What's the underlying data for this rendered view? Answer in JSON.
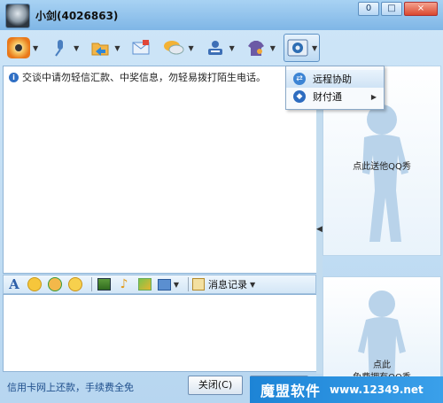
{
  "window": {
    "title": "小剑(4026863)",
    "controls": {
      "minimize": "0",
      "maximize": "□",
      "close": "×"
    }
  },
  "toolbar": {
    "items": [
      {
        "name": "video",
        "icon": "webcam-icon",
        "glyph": "●",
        "color": "#f29a1c"
      },
      {
        "name": "voice",
        "icon": "microphone-icon",
        "glyph": "🎤",
        "color": "#4a7fc0"
      },
      {
        "name": "file-transfer",
        "icon": "folder-icon",
        "glyph": "📂",
        "color": "#f2a93b"
      },
      {
        "name": "sms",
        "icon": "envelope-icon",
        "glyph": "✉",
        "color": "#5d8fd0"
      },
      {
        "name": "chat-room",
        "icon": "speech-bubble-icon",
        "glyph": "💬",
        "color": "#f2b134"
      },
      {
        "name": "profile",
        "icon": "id-card-icon",
        "glyph": "👤",
        "color": "#3d6fb6"
      },
      {
        "name": "show",
        "icon": "shirt-icon",
        "glyph": "👕",
        "color": "#6b5aa5"
      },
      {
        "name": "apps",
        "icon": "gear-icon",
        "glyph": "⚙",
        "color": "#2e6db3"
      }
    ]
  },
  "chat": {
    "notice": "交谈中请勿轻信汇款、中奖信息，勿轻易拨打陌生电话。"
  },
  "menu": {
    "items": [
      {
        "label": "远程协助",
        "icon": "remote-assist-icon"
      },
      {
        "label": "财付通",
        "icon": "tenpay-icon",
        "has_submenu": true
      }
    ]
  },
  "input_toolbar": {
    "history_label": "消息记录"
  },
  "bottom": {
    "info_text": "信用卡网上还款，手续费全免",
    "close_label": "关闭(C)"
  },
  "show_panel": {
    "top_label": "点此送他QQ秀",
    "bottom_label_1": "点此",
    "bottom_label_2": "免费拥有QQ秀"
  },
  "watermark": {
    "brand": "魔盟软件",
    "url": "www.12349.net"
  }
}
